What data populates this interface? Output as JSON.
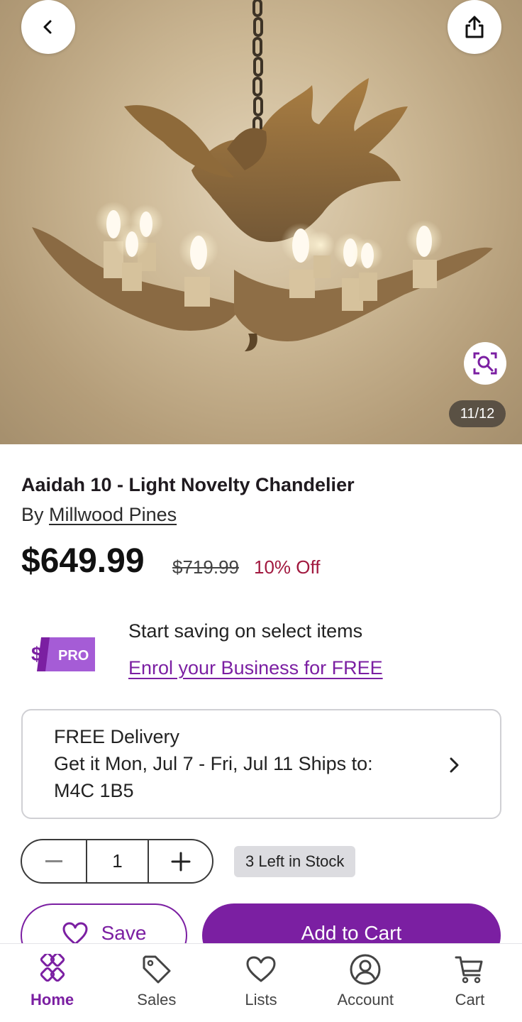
{
  "gallery": {
    "counter": "11/12"
  },
  "product": {
    "title": "Aaidah 10 - Light Novelty Chandelier",
    "by_label": "By",
    "brand": "Millwood Pines",
    "price": "$649.99",
    "old_price": "$719.99",
    "discount": "10% Off"
  },
  "pro_promo": {
    "badge_dollar": "$",
    "badge_text": "PRO",
    "line1": "Start saving on select items",
    "link": "Enrol your Business for FREE"
  },
  "delivery": {
    "line1": "FREE Delivery",
    "line2": "Get it Mon, Jul 7 - Fri, Jul 11 Ships to:",
    "line3": "M4C 1B5"
  },
  "quantity": {
    "value": "1",
    "stock": "3 Left in Stock"
  },
  "actions": {
    "save_label": "Save",
    "add_to_cart_label": "Add to Cart"
  },
  "nav": {
    "items": [
      {
        "label": "Home",
        "icon": "home-icon",
        "active": true
      },
      {
        "label": "Sales",
        "icon": "tag-icon",
        "active": false
      },
      {
        "label": "Lists",
        "icon": "heart-icon",
        "active": false
      },
      {
        "label": "Account",
        "icon": "account-icon",
        "active": false
      },
      {
        "label": "Cart",
        "icon": "cart-icon",
        "active": false
      }
    ]
  },
  "colors": {
    "accent": "#7b1fa2",
    "discount": "#a1193f",
    "stock_badge": "#dcdce0"
  }
}
